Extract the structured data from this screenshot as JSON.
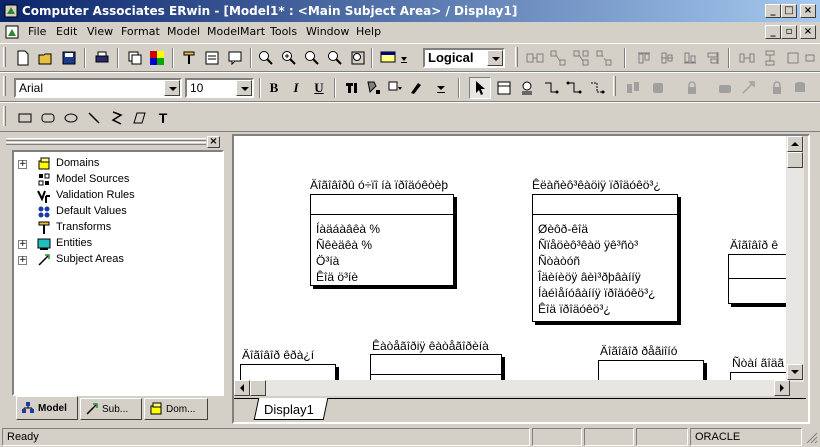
{
  "window": {
    "title": "Computer Associates ERwin - [Model1* : <Main Subject Area> / Display1]",
    "controls": {
      "minimize": "_",
      "maximize": "□",
      "close": "×"
    }
  },
  "menu": {
    "items": [
      "File",
      "Edit",
      "View",
      "Format",
      "Model",
      "ModelMart",
      "Tools",
      "Window",
      "Help"
    ]
  },
  "toolbar": {
    "view_level": "Logical",
    "font_name": "Arial",
    "font_size": "10",
    "bold": "B",
    "italic": "I",
    "underline": "U",
    "text_tool": "T"
  },
  "tree": {
    "items": [
      {
        "label": "Domains",
        "expander": "+",
        "icon": "domains-icon"
      },
      {
        "label": "Model Sources",
        "expander": "",
        "icon": "model-sources-icon"
      },
      {
        "label": "Validation Rules",
        "expander": "",
        "icon": "validation-rules-icon"
      },
      {
        "label": "Default Values",
        "expander": "",
        "icon": "default-values-icon"
      },
      {
        "label": "Transforms",
        "expander": "",
        "icon": "transforms-icon"
      },
      {
        "label": "Entities",
        "expander": "+",
        "icon": "entities-icon"
      },
      {
        "label": "Subject Areas",
        "expander": "+",
        "icon": "subject-areas-icon"
      }
    ]
  },
  "left_tabs": [
    "Model",
    "Sub...",
    "Dom..."
  ],
  "entities": [
    {
      "name": "Äîãîâîðû ó÷ïî íà ïðîäóêòèþ",
      "attributes": [
        "Íàäáàâêà %",
        "Ñêèäêà %",
        "Ö³íà",
        "Êîä ö³íè"
      ]
    },
    {
      "name": "Êëàñèô³êàöiÿ ïðîäóêö³¿",
      "attributes": [
        "Øèôð-êîä",
        "Ñïåöèô³êàö ÿê³ñò³",
        "Ñòàòóñ",
        "Îäèíèöÿ âèì³ðþâàííÿ",
        "Íàéìåíóâàííÿ ïðîäóêö³¿",
        "Êîä ïðîäóêö³¿"
      ]
    },
    {
      "name": "Äîãîâîð ê",
      "attributes": []
    },
    {
      "name": "Äîãîâîð êðà¿í",
      "attributes": []
    },
    {
      "name": "Êàòåãîðiÿ êàòåãîðèíà",
      "attributes": []
    },
    {
      "name": "Äîãîâîð ðåãiîíó",
      "attributes": []
    },
    {
      "name": "Ñòàí ãîäã",
      "attributes": []
    }
  ],
  "canvas_tab": "Display1",
  "status": {
    "text": "Ready",
    "db": "ORACLE"
  }
}
